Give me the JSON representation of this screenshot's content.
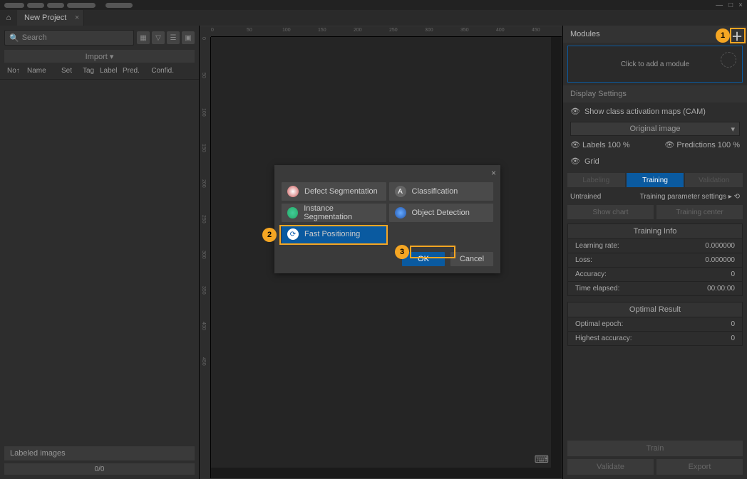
{
  "titlebar": {
    "min": "—",
    "max": "□",
    "close": "×"
  },
  "tab": {
    "title": "New Project"
  },
  "search": {
    "placeholder": "Search"
  },
  "import": "Import ▾",
  "columns": {
    "no": "No↑",
    "name": "Name",
    "set": "Set",
    "tag": "Tag",
    "label": "Label",
    "pred": "Pred.",
    "confid": "Confid."
  },
  "labeled": "Labeled images",
  "progress": "0/0",
  "ruler": [
    "0",
    "50",
    "100",
    "150",
    "200",
    "250",
    "300",
    "350",
    "400",
    "450"
  ],
  "r": {
    "modules_title": "Modules",
    "add_module": "Click to add a module",
    "display_settings": "Display Settings",
    "show_cam": "Show class activation maps (CAM)",
    "original_image": "Original image",
    "labels": "Labels",
    "labels_pct": "100 %",
    "predictions": "Predictions",
    "predictions_pct": "100 %",
    "grid": "Grid",
    "tab1": "Labeling",
    "tab2": "Training",
    "tab3": "Validation",
    "untrained": "Untrained",
    "training_settings": "Training parameter settings ▸",
    "show_chart": "Show chart",
    "training_center": "Training center",
    "training_info": "Training Info",
    "lr": "Learning rate:",
    "lr_v": "0.000000",
    "loss": "Loss:",
    "loss_v": "0.000000",
    "acc": "Accuracy:",
    "acc_v": "0",
    "time": "Time elapsed:",
    "time_v": "00:00:00",
    "optimal": "Optimal Result",
    "epoch": "Optimal epoch:",
    "epoch_v": "0",
    "hacc": "Highest accuracy:",
    "hacc_v": "0",
    "train": "Train",
    "validate": "Validate",
    "export": "Export"
  },
  "modal": {
    "defect": "Defect Segmentation",
    "class": "Classification",
    "instance": "Instance Segmentation",
    "object": "Object Detection",
    "fast": "Fast Positioning",
    "ok": "OK",
    "cancel": "Cancel"
  },
  "callouts": {
    "c1": "1",
    "c2": "2",
    "c3": "3"
  }
}
